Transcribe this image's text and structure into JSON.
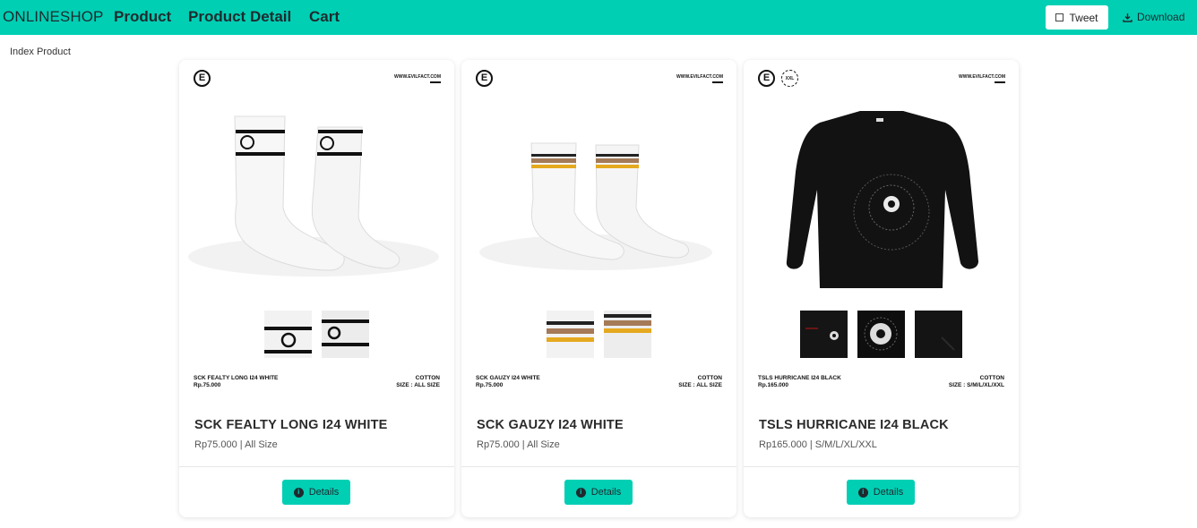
{
  "nav": {
    "brand": "ONLINESHOP",
    "links": [
      "Product",
      "Product Detail",
      "Cart"
    ],
    "tweet_label": "Tweet",
    "download_label": "Download"
  },
  "breadcrumb": "Index Product",
  "brand_mark": {
    "site": "WWW.EVILFACT.COM",
    "logo_letter": "E",
    "size_badge": "XXL"
  },
  "products": [
    {
      "image_caption_name": "SCK FEALTY LONG I24 WHITE",
      "image_caption_price": "Rp.75.000",
      "image_material": "COTTON",
      "image_size": "SIZE : ALL SIZE",
      "title": "SCK FEALTY LONG I24 WHITE",
      "subtitle": "Rp75.000 | All Size",
      "button_label": "Details"
    },
    {
      "image_caption_name": "SCK GAUZY I24 WHITE",
      "image_caption_price": "Rp.75.000",
      "image_material": "COTTON",
      "image_size": "SIZE : ALL SIZE",
      "title": "SCK GAUZY I24 WHITE",
      "subtitle": "Rp75.000 | All Size",
      "button_label": "Details"
    },
    {
      "image_caption_name": "TSLS HURRICANE I24 BLACK",
      "image_caption_price": "Rp.165.000",
      "image_material": "COTTON",
      "image_size": "SIZE : S/M/L/XL/XXL",
      "title": "TSLS HURRICANE I24 BLACK",
      "subtitle": "Rp165.000 | S/M/L/XL/XXL",
      "button_label": "Details"
    }
  ],
  "colors": {
    "accent": "#00cfb4",
    "text_dark": "#1f2a2e"
  }
}
